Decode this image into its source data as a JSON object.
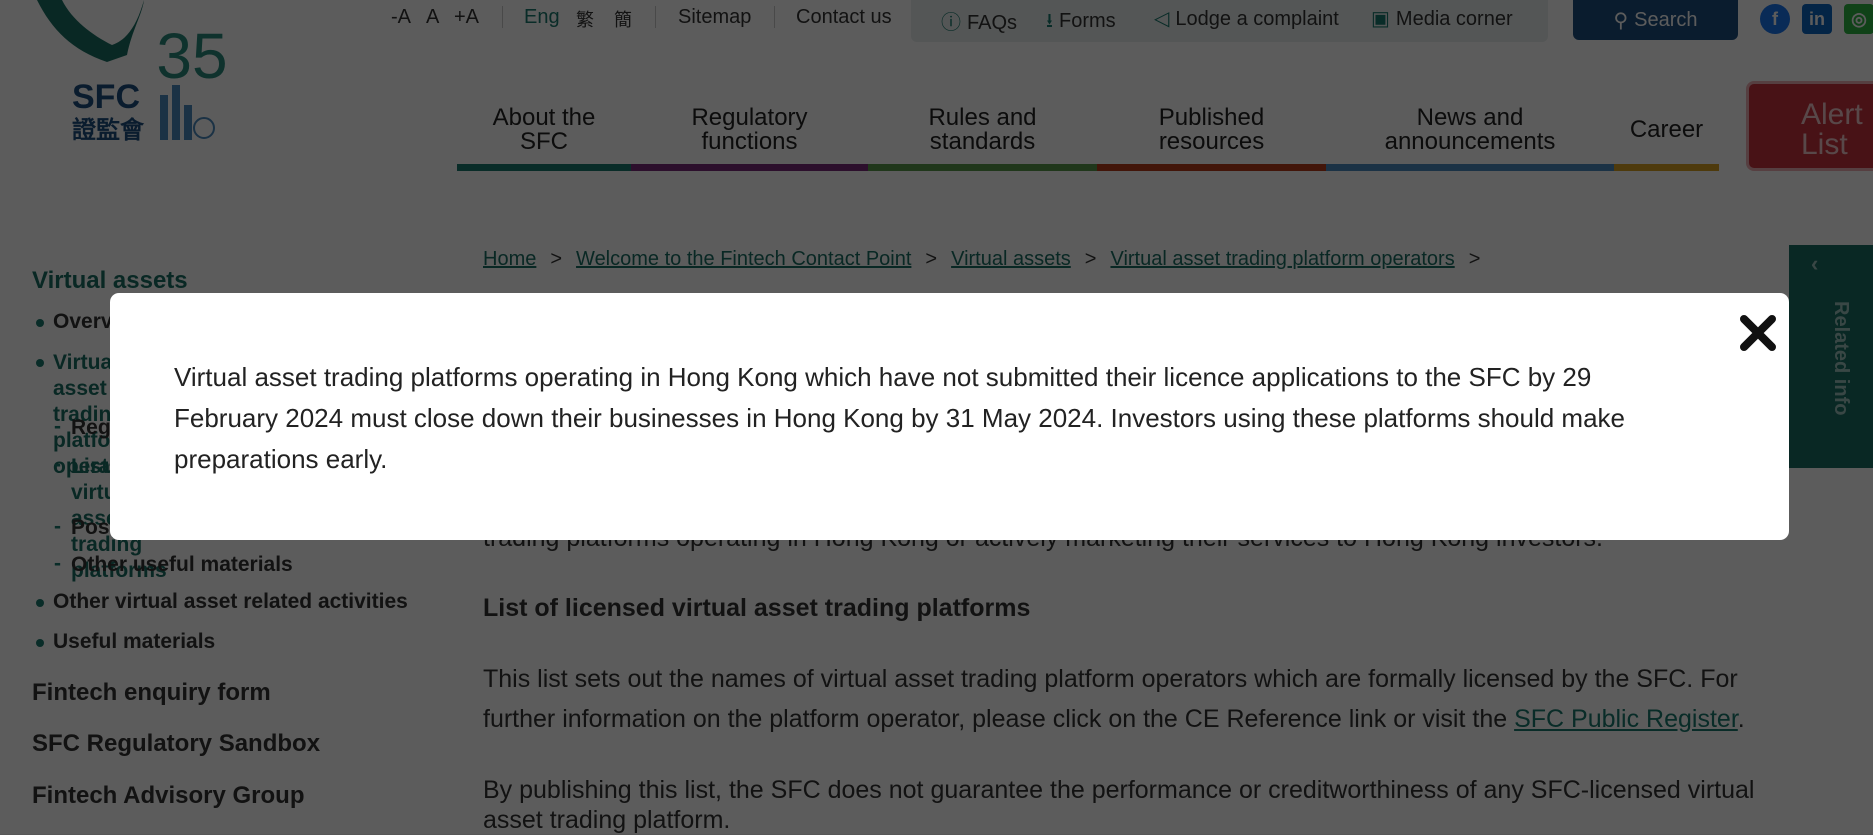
{
  "header": {
    "logo_text": "SFC 35 證監會",
    "font_size_controls": [
      "-A",
      "A",
      "+A"
    ],
    "languages": [
      "Eng",
      "繁",
      "簡"
    ],
    "sitemap": "Sitemap",
    "contact": "Contact us",
    "quick_links": [
      {
        "label": "FAQs",
        "icon": "question-circle-icon"
      },
      {
        "label": "Forms",
        "icon": "download-icon"
      },
      {
        "label": "Lodge a complaint",
        "icon": "megaphone-icon"
      },
      {
        "label": "Media corner",
        "icon": "image-icon"
      }
    ],
    "search_label": "Search",
    "social": [
      "facebook-icon",
      "linkedin-icon",
      "wechat-icon"
    ]
  },
  "nav": {
    "items": [
      {
        "label": "About the SFC",
        "color": "#1a7a6e"
      },
      {
        "label": "Regulatory functions",
        "color": "#7a2a7a"
      },
      {
        "label": "Rules and standards",
        "color": "#5a9a4a"
      },
      {
        "label": "Published resources",
        "color": "#b83a1a"
      },
      {
        "label": "News and announcements",
        "color": "#4a8ac0"
      },
      {
        "label": "Career",
        "color": "#d8a020"
      }
    ],
    "alert_list": "Alert List"
  },
  "sidebar": {
    "title": "Virtual assets",
    "items": [
      "Overview",
      "Virtual asset trading platform operators",
      "Regulatory requirements",
      "Lists of virtual asset trading platforms",
      "Post-licensing",
      "Other useful materials",
      "Other virtual asset related activities",
      "Useful materials"
    ],
    "sections": [
      "Fintech enquiry form",
      "SFC Regulatory Sandbox",
      "Fintech Advisory Group"
    ]
  },
  "breadcrumb": [
    "Home",
    "Welcome to the Fintech Contact Point",
    "Virtual assets",
    "Virtual asset trading platform operators"
  ],
  "related_info": "Related info",
  "main": {
    "partial_line": "trading platforms operating in Hong Kong or actively marketing their services to Hong Kong investors.",
    "heading": "List of licensed virtual asset trading platforms",
    "para1_line1": "This list sets out the names of virtual asset trading platform operators which are formally licensed by the SFC. For",
    "para1_line2": "further information on the platform operator, please click on the CE Reference link or visit the ",
    "para1_link": "SFC Public Register",
    "para1_end": ".",
    "para2_line1": "By publishing this list, the SFC does not guarantee the performance or creditworthiness of any SFC-licensed virtual",
    "para2_line2": "asset trading platform."
  },
  "modal": {
    "text": "Virtual asset trading platforms operating in Hong Kong which have not submitted their licence applications to the SFC by 29 February 2024 must close down their businesses in Hong Kong by 31 May 2024. Investors using these platforms should make preparations early.",
    "close_icon": "close-icon"
  }
}
